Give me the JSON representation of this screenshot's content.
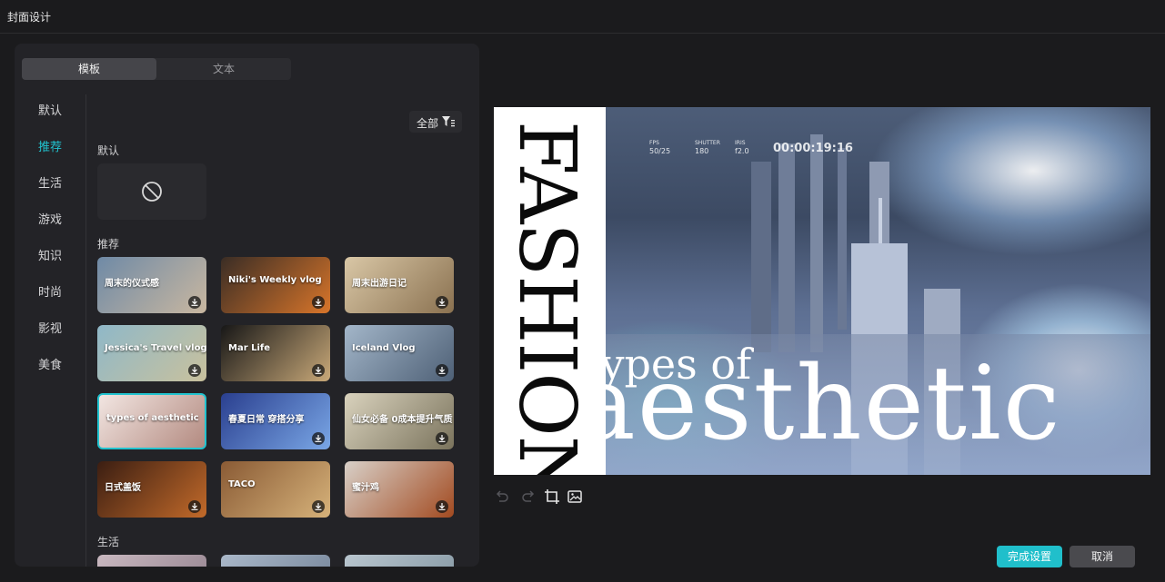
{
  "window": {
    "title": "封面设计"
  },
  "tabs": {
    "template": "模板",
    "text": "文本"
  },
  "categories": [
    "默认",
    "推荐",
    "生活",
    "游戏",
    "知识",
    "时尚",
    "影视",
    "美食"
  ],
  "active_category": "推荐",
  "filter": {
    "label": "全部",
    "icon": "filter-icon"
  },
  "sections": {
    "default": "默认",
    "recommended": "推荐",
    "life": "生活"
  },
  "none_icon": "no-cover-icon",
  "thumbnails": [
    {
      "caption": "周末的仪式感",
      "colors": [
        "#6f8aa6",
        "#c9b7a0"
      ]
    },
    {
      "caption": "Niki's Weekly vlog",
      "colors": [
        "#3a2d25",
        "#d8752a"
      ]
    },
    {
      "caption": "周末出游日记",
      "colors": [
        "#d9c7a6",
        "#8a7150"
      ]
    },
    {
      "caption": "Jessica's Travel vlog",
      "colors": [
        "#8fb8c8",
        "#c9c19d"
      ]
    },
    {
      "caption": "Mar Life",
      "colors": [
        "#171717",
        "#c9a979"
      ]
    },
    {
      "caption": "Iceland Vlog",
      "colors": [
        "#a3b6c9",
        "#4e6076"
      ]
    },
    {
      "caption": "types of aesthetic",
      "colors": [
        "#f2e6e2",
        "#b38a80"
      ]
    },
    {
      "caption": "春夏日常 穿搭分享",
      "colors": [
        "#2a3f8f",
        "#7aa7e6"
      ]
    },
    {
      "caption": "仙女必备 0成本提升气质",
      "colors": [
        "#d9d2bd",
        "#7a735c"
      ]
    },
    {
      "caption": "日式盖饭",
      "colors": [
        "#3b1e12",
        "#c26a2a"
      ]
    },
    {
      "caption": "TACO",
      "colors": [
        "#8a5b35",
        "#d6b27a"
      ]
    },
    {
      "caption": "蜜汁鸡",
      "colors": [
        "#d8d0c8",
        "#a24a20"
      ]
    }
  ],
  "preview": {
    "vertical_title": "FASHION",
    "subtitle": "types of",
    "headline": "aesthetic",
    "hud": {
      "fps_label": "FPS",
      "fps": "50/25",
      "shutter_label": "SHUTTER",
      "shutter": "180",
      "iris_label": "IRIS",
      "iris": "f2.0",
      "timecode": "00:00:19:16"
    }
  },
  "tools": [
    "undo-icon",
    "redo-icon",
    "crop-icon",
    "replace-image-icon"
  ],
  "buttons": {
    "done": "完成设置",
    "cancel": "取消"
  },
  "colors": {
    "accent": "#21c3cf",
    "done_button": "#20bfcb"
  }
}
